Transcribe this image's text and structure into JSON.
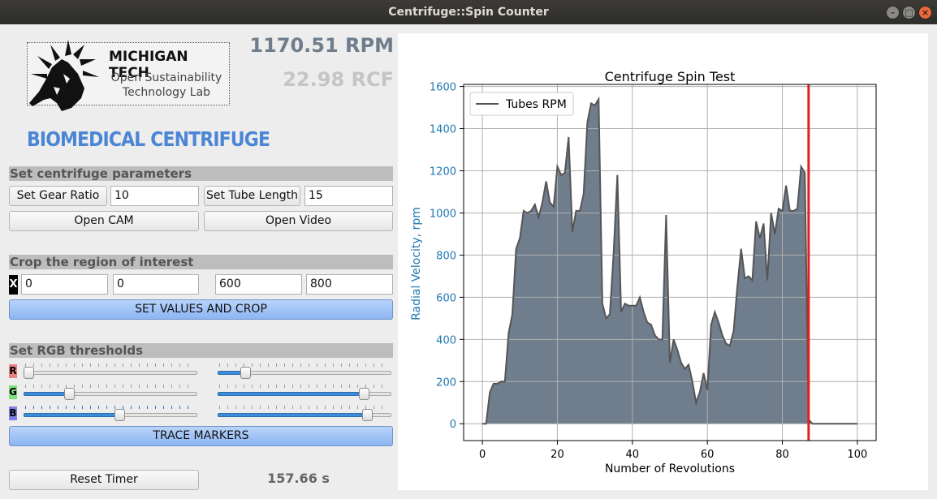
{
  "window": {
    "title": "Centrifuge::Spin Counter"
  },
  "logo": {
    "name": "MICHIGAN TECH",
    "sub_line1": "Open Sustainability",
    "sub_line2": "Technology Lab"
  },
  "heading": "BIOMEDICAL CENTRIFUGE",
  "readout": {
    "rpm": "1170.51 RPM",
    "rcf": "22.98 RCF"
  },
  "params": {
    "section": "Set centrifuge parameters",
    "gear_button": "Set Gear Ratio",
    "gear_value": "10",
    "tube_button": "Set Tube Length",
    "tube_value": "15",
    "open_cam": "Open CAM",
    "open_video": "Open Video"
  },
  "crop": {
    "section": "Crop the region of interest",
    "x_label": "X",
    "x1": "0",
    "y1": "0",
    "x2": "600",
    "y2": "800",
    "apply_button": "SET VALUES AND CROP"
  },
  "rgb": {
    "section": "Set RGB thresholds",
    "channels": [
      {
        "label": "R",
        "color": "#e88080",
        "low": 0.03,
        "high": 0.16
      },
      {
        "label": "G",
        "color": "#7fe07f",
        "low": 0.26,
        "high": 0.84
      },
      {
        "label": "B",
        "color": "#7e7ee6",
        "low": 0.55,
        "high": 0.86
      }
    ],
    "trace_button": "TRACE MARKERS"
  },
  "timer": {
    "reset_button": "Reset Timer",
    "elapsed": "157.66 s"
  },
  "chart_data": {
    "type": "area",
    "title": "Centrifuge Spin Test",
    "xlabel": "Number of Revolutions",
    "ylabel": "Radial Velocity, rpm",
    "xlim": [
      -5,
      105
    ],
    "ylim": [
      -80,
      1610
    ],
    "xticks": [
      0,
      20,
      40,
      60,
      80,
      100
    ],
    "yticks": [
      0,
      200,
      400,
      600,
      800,
      1000,
      1200,
      1400,
      1600
    ],
    "grid": true,
    "legend_position": "top-left",
    "fill_color": "#6f7d8c",
    "line_color": "#555555",
    "marker_color": "#e02020",
    "marker_x": 87,
    "series": [
      {
        "name": "Tubes RPM",
        "x": [
          0,
          1,
          2,
          3,
          4,
          5,
          6,
          7,
          8,
          9,
          10,
          11,
          12,
          13,
          14,
          15,
          16,
          17,
          18,
          19,
          20,
          21,
          22,
          23,
          24,
          25,
          26,
          27,
          28,
          29,
          30,
          31,
          32,
          33,
          34,
          35,
          36,
          37,
          38,
          39,
          40,
          41,
          42,
          43,
          44,
          45,
          46,
          47,
          48,
          49,
          50,
          51,
          52,
          53,
          54,
          55,
          56,
          57,
          58,
          59,
          60,
          61,
          62,
          63,
          64,
          65,
          66,
          67,
          68,
          69,
          70,
          71,
          72,
          73,
          74,
          75,
          76,
          77,
          78,
          79,
          80,
          81,
          82,
          83,
          84,
          85,
          86,
          87,
          88,
          100
        ],
        "y": [
          0,
          0,
          150,
          190,
          190,
          200,
          200,
          430,
          520,
          830,
          880,
          1010,
          1000,
          1010,
          1040,
          980,
          1050,
          1150,
          1050,
          1030,
          1220,
          1180,
          1190,
          1360,
          910,
          1010,
          1010,
          1090,
          1430,
          1520,
          1510,
          1540,
          570,
          500,
          520,
          810,
          1180,
          530,
          570,
          560,
          560,
          560,
          600,
          530,
          480,
          470,
          420,
          400,
          400,
          990,
          290,
          400,
          350,
          290,
          260,
          280,
          200,
          100,
          150,
          240,
          160,
          470,
          530,
          480,
          420,
          380,
          370,
          440,
          650,
          830,
          690,
          700,
          680,
          960,
          880,
          950,
          680,
          1000,
          900,
          1020,
          1010,
          1130,
          1010,
          1010,
          1020,
          1220,
          1190,
          20,
          0,
          0
        ]
      }
    ]
  }
}
